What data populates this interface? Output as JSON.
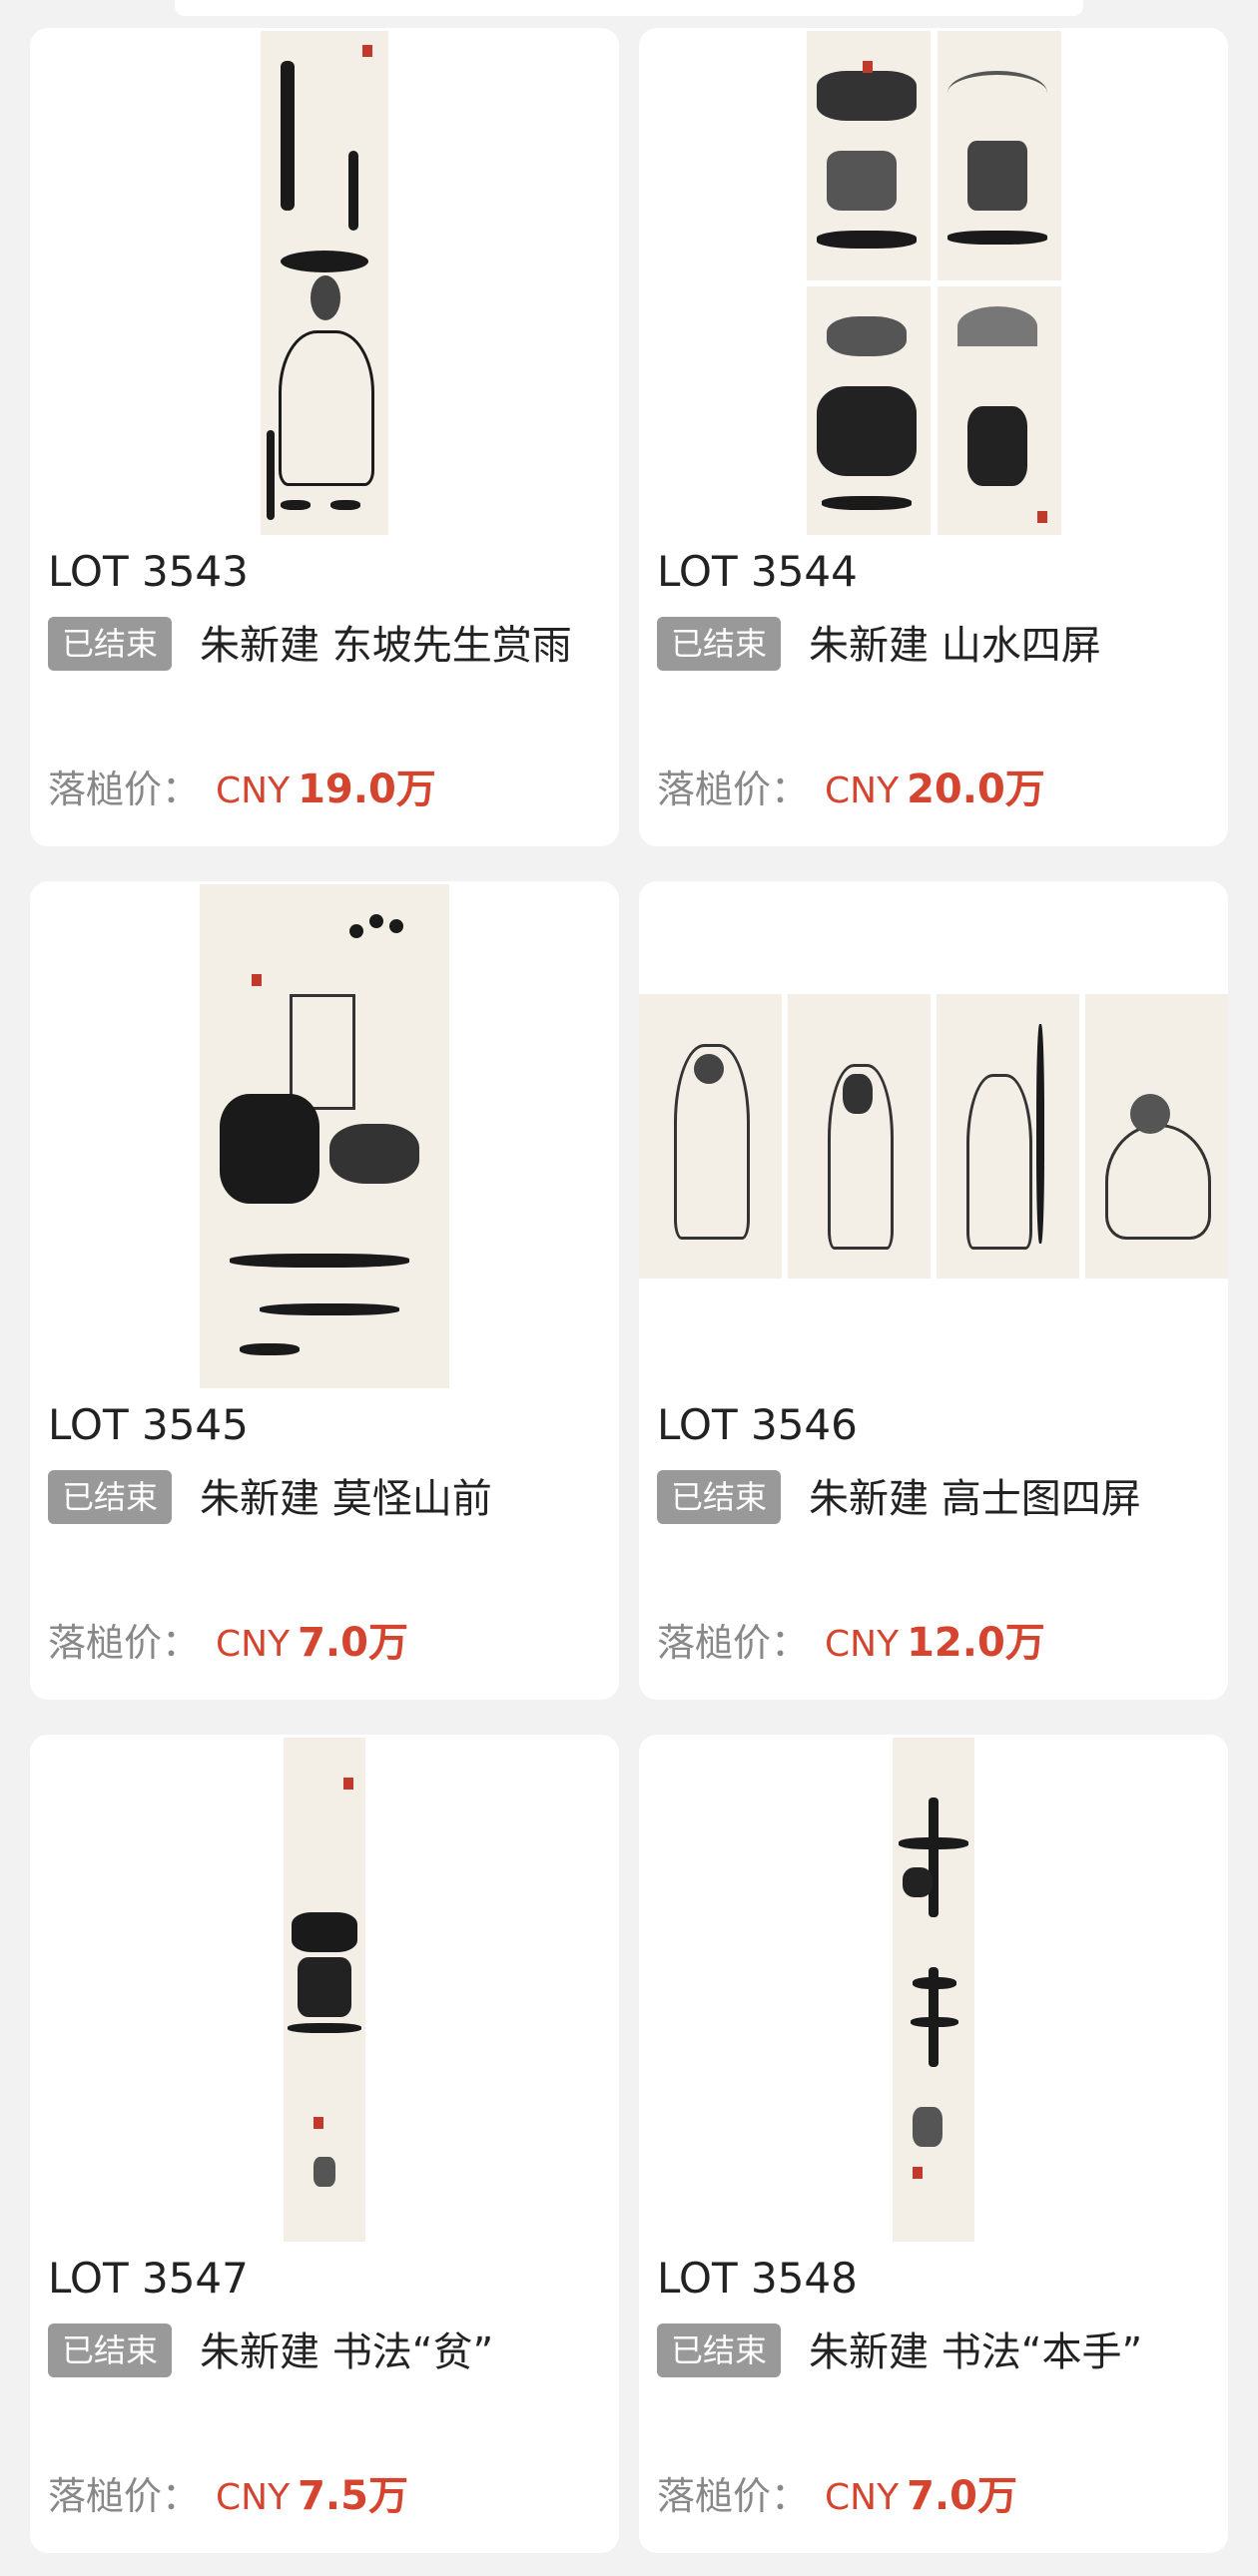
{
  "lots": [
    {
      "lot": "LOT 3543",
      "status": "已结束",
      "title": "朱新建 东坡先生赏雨",
      "price_label": "落槌价：",
      "currency": "CNY",
      "price": "19.0万",
      "image": "portrait-scroll"
    },
    {
      "lot": "LOT 3544",
      "status": "已结束",
      "title": "朱新建 山水四屏",
      "price_label": "落槌价：",
      "currency": "CNY",
      "price": "20.0万",
      "image": "landscape-four-panel"
    },
    {
      "lot": "LOT 3545",
      "status": "已结束",
      "title": "朱新建 莫怪山前",
      "price_label": "落槌价：",
      "currency": "CNY",
      "price": "7.0万",
      "image": "landscape-scroll"
    },
    {
      "lot": "LOT 3546",
      "status": "已结束",
      "title": "朱新建 高士图四屏",
      "price_label": "落槌价：",
      "currency": "CNY",
      "price": "12.0万",
      "image": "figures-four-panel"
    },
    {
      "lot": "LOT 3547",
      "status": "已结束",
      "title": "朱新建 书法“贫”",
      "price_label": "落槌价：",
      "currency": "CNY",
      "price": "7.5万",
      "image": "calligraphy-scroll"
    },
    {
      "lot": "LOT 3548",
      "status": "已结束",
      "title": "朱新建 书法“本手”",
      "price_label": "落槌价：",
      "currency": "CNY",
      "price": "7.0万",
      "image": "calligraphy-scroll"
    }
  ],
  "colors": {
    "price": "#d4442e",
    "badge_bg": "#999999",
    "page_bg": "#f2f2f2"
  }
}
